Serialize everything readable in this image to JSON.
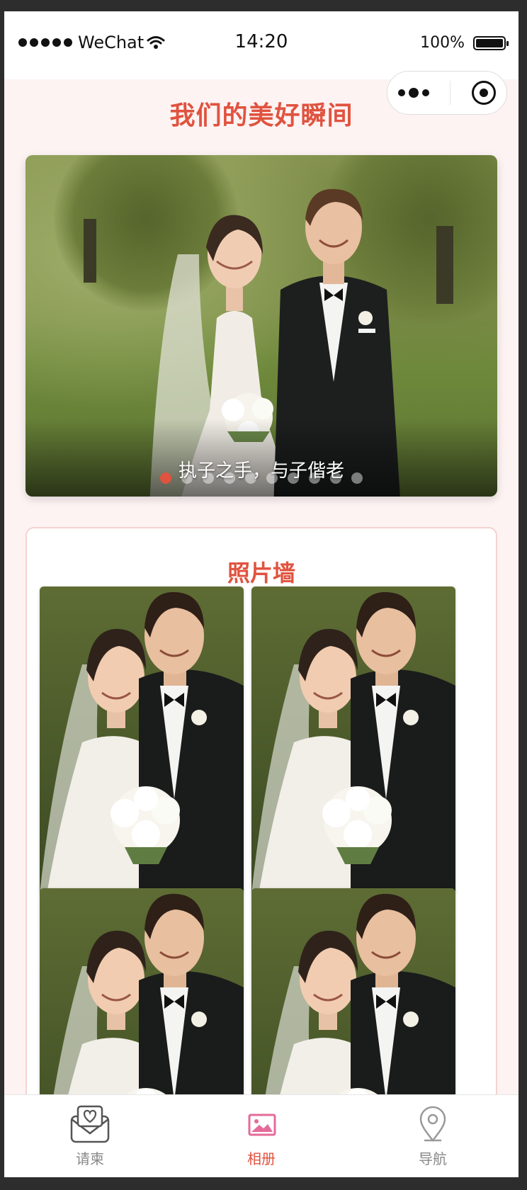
{
  "status_bar": {
    "carrier": "WeChat",
    "time": "14:20",
    "battery": "100%"
  },
  "page": {
    "title": "我们的美好瞬间"
  },
  "banner": {
    "caption": "执子之手，与子偕老",
    "slide_count": 10,
    "active_index": 0
  },
  "photo_wall": {
    "title": "照片墙"
  },
  "tabbar": {
    "items": [
      {
        "label": "请柬",
        "icon": "invitation-heart-icon",
        "active": false
      },
      {
        "label": "相册",
        "icon": "image-icon",
        "active": true
      },
      {
        "label": "导航",
        "icon": "location-pin-icon",
        "active": false
      }
    ]
  },
  "colors": {
    "accent": "#e0533f",
    "page_bg": "#fdf3f3",
    "card_border": "#f5d2d0",
    "tab_active_icon": "#e46b9a"
  }
}
